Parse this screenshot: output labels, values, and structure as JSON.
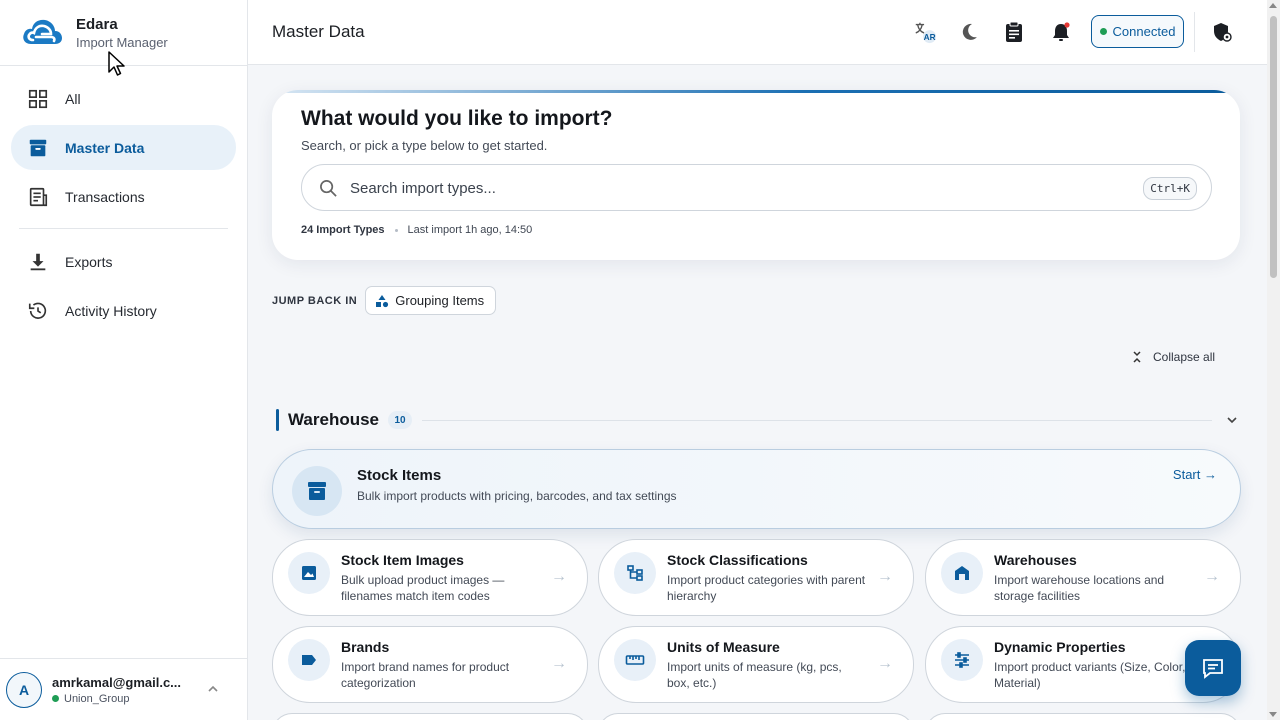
{
  "brand": {
    "name": "Edara",
    "subtitle": "Import Manager"
  },
  "sidebar": {
    "items": [
      {
        "label": "All",
        "icon": "grid-icon",
        "active": false
      },
      {
        "label": "Master Data",
        "icon": "archive-box-icon",
        "active": true
      },
      {
        "label": "Transactions",
        "icon": "receipt-icon",
        "active": false
      },
      {
        "label": "Exports",
        "icon": "download-icon",
        "active": false
      },
      {
        "label": "Activity History",
        "icon": "history-icon",
        "active": false
      }
    ],
    "user": {
      "initial": "A",
      "email": "amrkamal@gmail.c...",
      "org": "Union_Group"
    }
  },
  "header": {
    "title": "Master Data",
    "language_badge": "AR",
    "connection_status": "Connected",
    "icons": [
      "translate-icon",
      "moon-icon",
      "clipboard-icon",
      "bell-icon",
      "shield-icon"
    ]
  },
  "hero": {
    "title": "What would you like to import?",
    "subtitle": "Search, or pick a type below to get started.",
    "search_placeholder": "Search import types...",
    "shortcut": "Ctrl+K",
    "import_types_count": "24 Import Types",
    "last_import": "Last import 1h ago, 14:50"
  },
  "jump_back": {
    "label": "JUMP BACK IN",
    "chip": "Grouping Items"
  },
  "collapse_label": "Collapse all",
  "section": {
    "title": "Warehouse",
    "count": "10",
    "featured": {
      "title": "Stock Items",
      "description": "Bulk import products with pricing, barcodes, and tax settings",
      "action": "Start →"
    },
    "cards": [
      {
        "title": "Stock Item Images",
        "description": "Bulk upload product images — filenames match item codes",
        "icon": "image-icon"
      },
      {
        "title": "Stock Classifications",
        "description": "Import product categories with parent hierarchy",
        "icon": "hierarchy-icon"
      },
      {
        "title": "Warehouses",
        "description": "Import warehouse locations and storage facilities",
        "icon": "warehouse-icon"
      },
      {
        "title": "Brands",
        "description": "Import brand names for product categorization",
        "icon": "label-icon"
      },
      {
        "title": "Units of Measure",
        "description": "Import units of measure (kg, pcs, box, etc.)",
        "icon": "ruler-icon"
      },
      {
        "title": "Dynamic Properties",
        "description": "Import product variants (Size, Color, Material)",
        "icon": "sliders-icon"
      }
    ]
  },
  "colors": {
    "accent": "#0b5c9c",
    "active_bg": "#e8f1f9",
    "status_green": "#1f9d55",
    "notification_red": "#e53935"
  }
}
